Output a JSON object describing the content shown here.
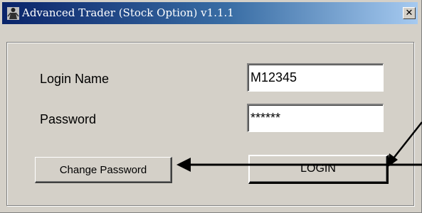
{
  "window": {
    "title": "Advanced Trader (Stock Option) v1.1.1",
    "app_icon": "trader-figure-icon",
    "close_glyph": "✕"
  },
  "form": {
    "login_name_label": "Login Name",
    "login_name_value": "M12345",
    "password_label": "Password",
    "password_value": "******"
  },
  "buttons": {
    "change_password_label": "Change Password",
    "login_label": "LOGIN"
  },
  "annotations": {
    "arrow_color": "#000000",
    "callouts": [
      "arrow-to-change-password",
      "arrow-to-login",
      "arrow-to-login-diagonal"
    ]
  },
  "colors": {
    "titlebar_start": "#0a246a",
    "titlebar_end": "#a6caf0",
    "dialog_face": "#d4d0c8"
  }
}
